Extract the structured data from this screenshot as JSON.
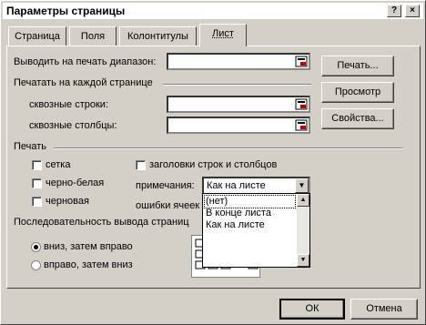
{
  "window": {
    "title": "Параметры страницы",
    "help_label": "?",
    "close_label": "×"
  },
  "tabs": [
    {
      "label": "Страница"
    },
    {
      "label": "Поля"
    },
    {
      "label": "Колонтитулы"
    },
    {
      "label": "Лист"
    }
  ],
  "print_area": {
    "label": "Выводить на печать диапазон:",
    "value": ""
  },
  "print_each_page": {
    "group_label": "Печатать на каждой странице",
    "rows_label": "сквозные строки:",
    "rows_value": "",
    "cols_label": "сквозные столбцы:",
    "cols_value": ""
  },
  "print_group": {
    "group_label": "Печать",
    "grid_label": "сетка",
    "grid_checked": false,
    "bw_label": "черно-белая",
    "bw_checked": false,
    "draft_label": "черновая",
    "draft_checked": false,
    "headers_label": "заголовки строк и столбцов",
    "headers_checked": false,
    "comments_label": "примечания:",
    "comments_value": "Как на листе",
    "errors_label": "ошибки ячеек как:"
  },
  "dropdown": {
    "options": [
      "(нет)",
      "В конце листа",
      "Как на листе"
    ],
    "highlighted": "(нет)"
  },
  "order": {
    "group_label": "Последовательность вывода страниц",
    "down_then_over": "вниз, затем вправо",
    "over_then_down": "вправо, затем вниз",
    "selected": "down_then_over"
  },
  "side_buttons": {
    "print": "Печать...",
    "preview": "Просмотр",
    "properties": "Свойства..."
  },
  "footer": {
    "ok": "ОК",
    "cancel": "Отмена"
  },
  "icons": [
    "range-select-icon",
    "chevron-down-icon",
    "scroll-up-icon",
    "scroll-down-icon",
    "page-order-icon"
  ]
}
